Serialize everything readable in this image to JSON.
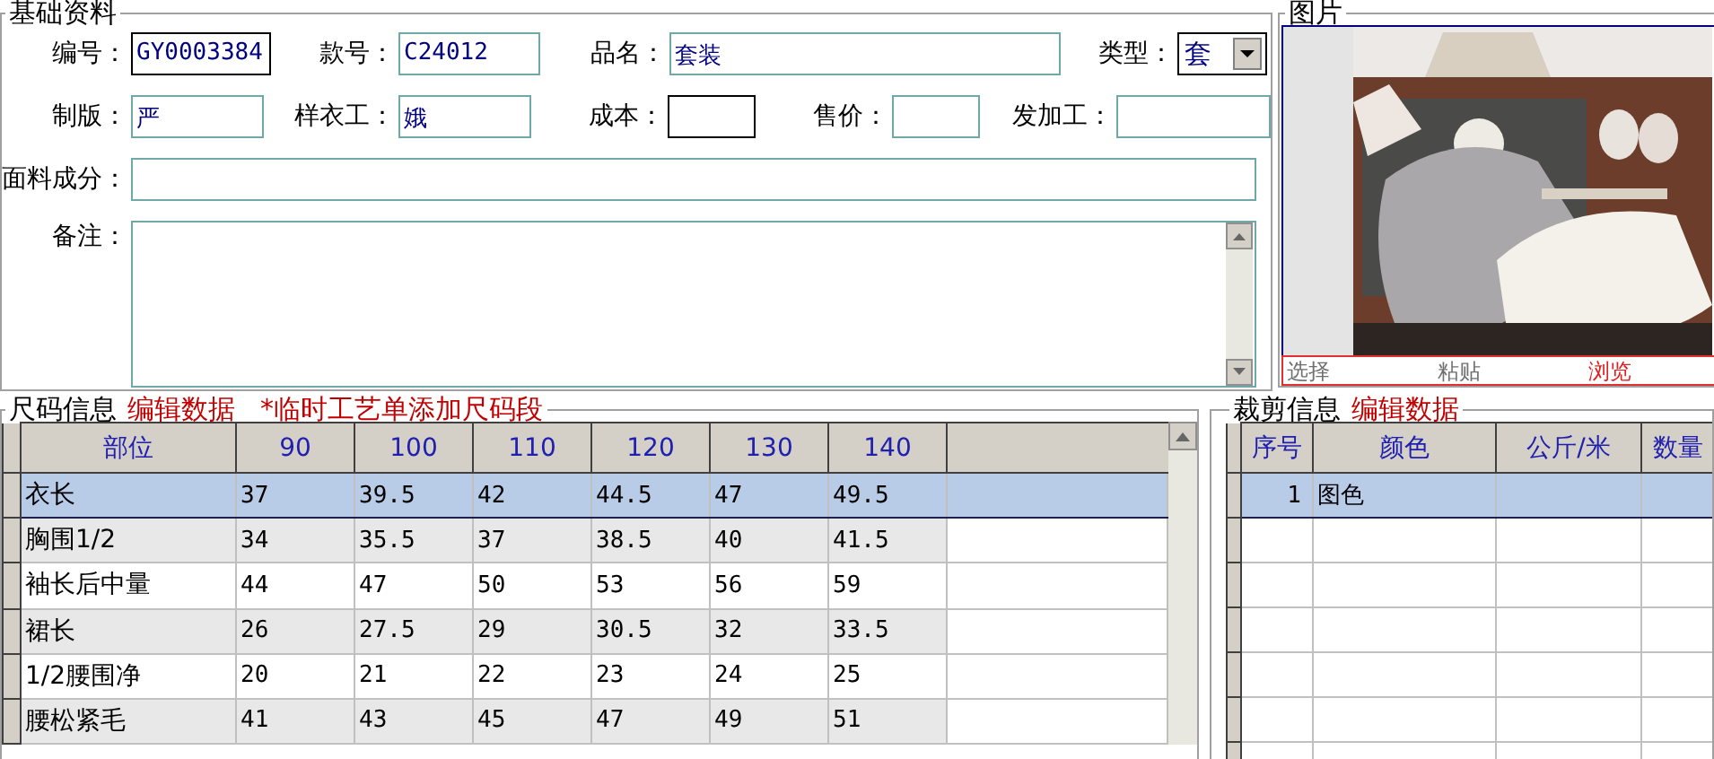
{
  "basic_info": {
    "title": "基础资料",
    "field_rows": [
      {
        "fields": [
          {
            "label": "编号：",
            "kind": "text",
            "value": "GY0003384",
            "framed": true
          },
          {
            "label": "款号：",
            "kind": "text",
            "value": "C24012",
            "framed": false
          },
          {
            "label": "品名：",
            "kind": "text",
            "value": "套装",
            "framed": false
          },
          {
            "label": "类型：",
            "kind": "select",
            "value": "套",
            "framed": true
          }
        ]
      },
      {
        "fields": [
          {
            "label": "制版：",
            "kind": "text",
            "value": "严",
            "framed": false
          },
          {
            "label": "样衣工：",
            "kind": "text",
            "value": "娥",
            "framed": false
          },
          {
            "label": "成本：",
            "kind": "text",
            "framed": true
          },
          {
            "label": "售价：",
            "kind": "text",
            "framed": false
          },
          {
            "label": "发加工：",
            "kind": "text",
            "framed": false
          }
        ]
      },
      {
        "fields": [
          {
            "label": "面料成分：",
            "kind": "text",
            "framed": false
          }
        ]
      },
      {
        "fields": [
          {
            "label": "备注：",
            "kind": "textarea",
            "framed": false
          }
        ]
      }
    ]
  },
  "picture_panel": {
    "title": "图片",
    "actions": [
      {
        "label": "选择",
        "disabled": true
      },
      {
        "label": "粘贴",
        "disabled": true
      },
      {
        "label": "浏览",
        "disabled": false
      }
    ]
  },
  "size_info": {
    "title": "尺码信息",
    "links": [
      "编辑数据",
      "*临时工艺单添加尺码段"
    ],
    "columns": [
      "部位",
      "90",
      "100",
      "110",
      "120",
      "130",
      "140"
    ],
    "rows": [
      {
        "cells": [
          "衣长",
          "37",
          "39.5",
          "42",
          "44.5",
          "47",
          "49.5"
        ],
        "selected": true
      },
      {
        "cells": [
          "胸围1/2",
          "34",
          "35.5",
          "37",
          "38.5",
          "40",
          "41.5"
        ],
        "selected": false
      },
      {
        "cells": [
          "袖长后中量",
          "44",
          "47",
          "50",
          "53",
          "56",
          "59"
        ],
        "selected": false
      },
      {
        "cells": [
          "裙长",
          "26",
          "27.5",
          "29",
          "30.5",
          "32",
          "33.5"
        ],
        "selected": false
      },
      {
        "cells": [
          "1/2腰围净",
          "20",
          "21",
          "22",
          "23",
          "24",
          "25"
        ],
        "selected": false
      },
      {
        "cells": [
          "腰松紧毛",
          "41",
          "43",
          "45",
          "47",
          "49",
          "51"
        ],
        "selected": false
      }
    ]
  },
  "cut_info": {
    "title": "裁剪信息",
    "links": [
      "编辑数据"
    ],
    "columns": [
      "序号",
      "颜色",
      "公斤/米",
      "数量"
    ],
    "rows": [
      {
        "cells": [
          "1",
          "图色"
        ],
        "selected": true
      }
    ]
  }
}
